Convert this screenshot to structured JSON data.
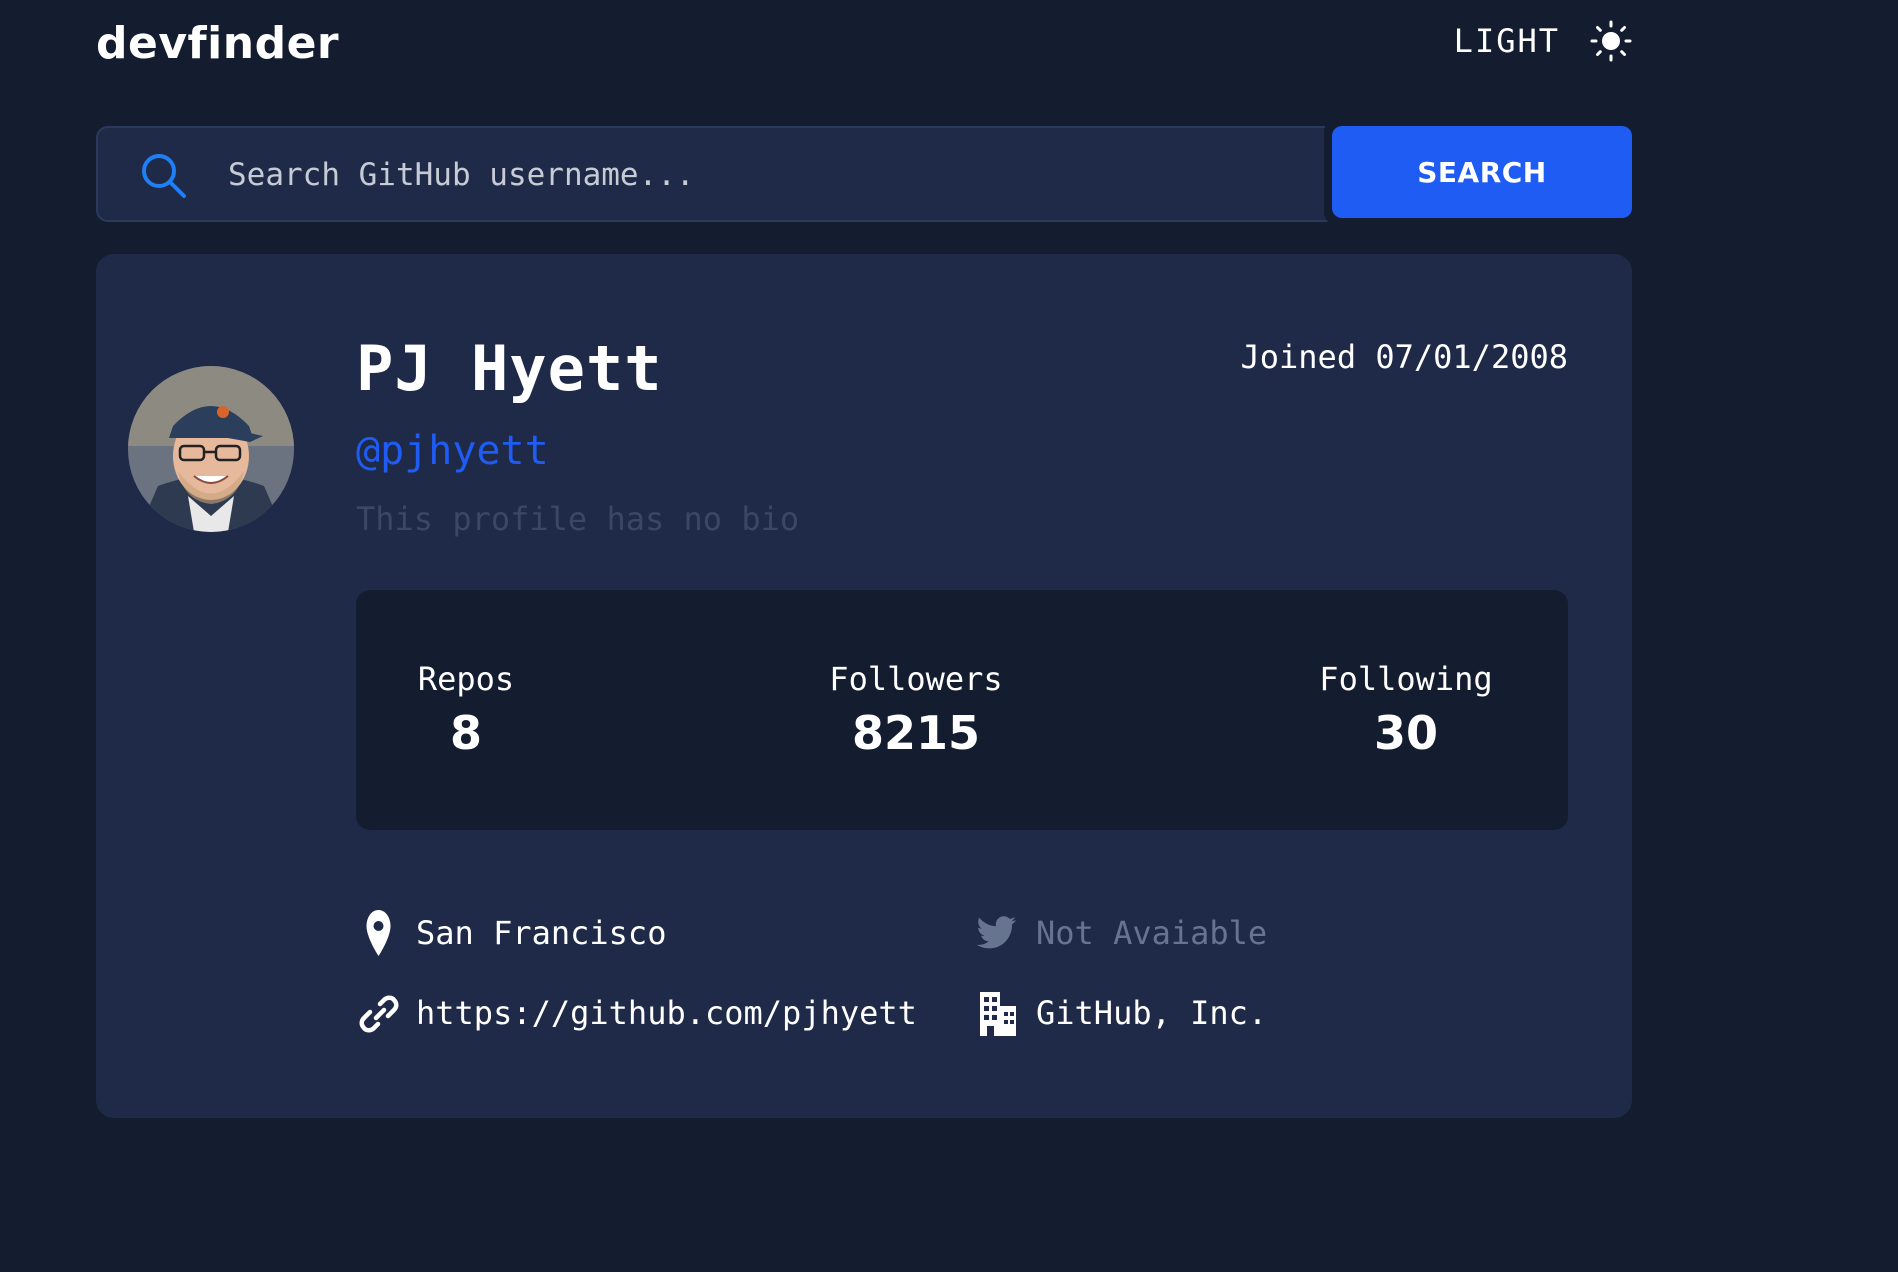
{
  "header": {
    "logo": "devfinder",
    "theme_label": "LIGHT",
    "theme_icon": "sun-icon"
  },
  "search": {
    "placeholder": "Search GitHub username...",
    "button_label": "SEARCH",
    "icon": "search-icon"
  },
  "profile": {
    "name": "PJ Hyett",
    "joined": "Joined 07/01/2008",
    "username": "@pjhyett",
    "bio": "This profile has no bio",
    "avatar": "avatar"
  },
  "stats": {
    "repos_label": "Repos",
    "repos_value": "8",
    "followers_label": "Followers",
    "followers_value": "8215",
    "following_label": "Following",
    "following_value": "30"
  },
  "links": {
    "location": "San Francisco",
    "twitter": "Not Avaiable",
    "blog": "https://github.com/pjhyett",
    "company": "GitHub, Inc."
  },
  "colors": {
    "background": "#141d2f",
    "card": "#1f2a48",
    "accent": "#1f5cf4",
    "muted": "#66748f"
  }
}
